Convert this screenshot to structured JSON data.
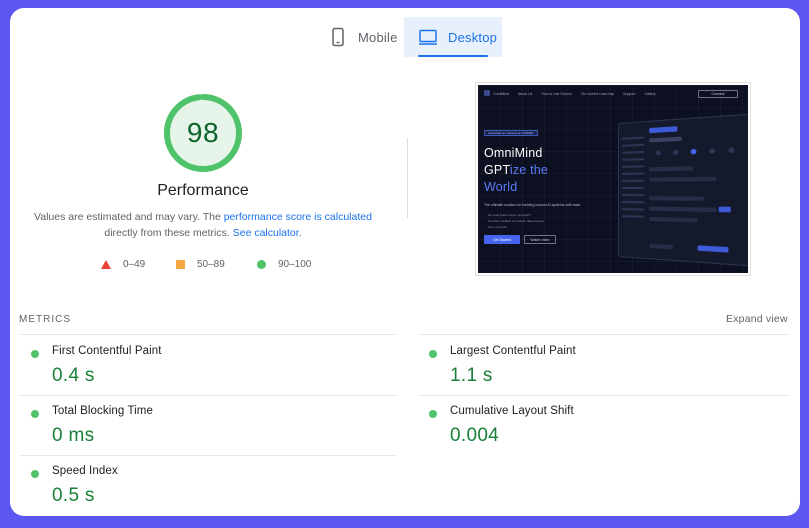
{
  "tabs": [
    {
      "label": "Mobile",
      "icon": "mobile-phone-icon",
      "selected": false
    },
    {
      "label": "Desktop",
      "icon": "desktop-monitor-icon",
      "selected": true
    }
  ],
  "performance": {
    "score": "98",
    "score_fraction": 0.98,
    "title": "Performance",
    "desc_prefix": "Values are estimated and may vary. The ",
    "desc_link1": "performance score is calculated",
    "desc_middle": " directly from these metrics. ",
    "desc_link2": "See calculator.",
    "color": "#0cce6b"
  },
  "legend": [
    {
      "range": "0–49",
      "shape": "triangle",
      "color": "#eb4335"
    },
    {
      "range": "50–89",
      "shape": "square",
      "color": "#f4a742"
    },
    {
      "range": "90–100",
      "shape": "circle",
      "color": "#4fc36a"
    }
  ],
  "screenshot": {
    "nav": [
      "OmniMind",
      "About Us",
      "How to Use Omnim",
      "Our current road map",
      "Support",
      "Gallery"
    ],
    "connect": "Connect",
    "badge": "Launched on mainnet on OMNIET",
    "headline_line1": "OmniMind",
    "headline_line2_white": "GPT",
    "headline_line2_blue": "ize the",
    "headline_line3": "World",
    "subheadline": "The ultimate solution for building custom AI systems with ease.",
    "bullets": [
      "No-code build custom OmniGPT",
      "Combine multiple AI models, data sources",
      "All-in-one GTL"
    ],
    "button_primary": "Get Started",
    "button_secondary": "Watch video"
  },
  "metrics": {
    "header": "METRICS",
    "expand": "Expand view",
    "items": [
      {
        "label": "First Contentful Paint",
        "value": "0.4 s"
      },
      {
        "label": "Largest Contentful Paint",
        "value": "1.1 s"
      },
      {
        "label": "Total Blocking Time",
        "value": "0 ms"
      },
      {
        "label": "Cumulative Layout Shift",
        "value": "0.004"
      },
      {
        "label": "Speed Index",
        "value": "0.5 s"
      }
    ]
  }
}
